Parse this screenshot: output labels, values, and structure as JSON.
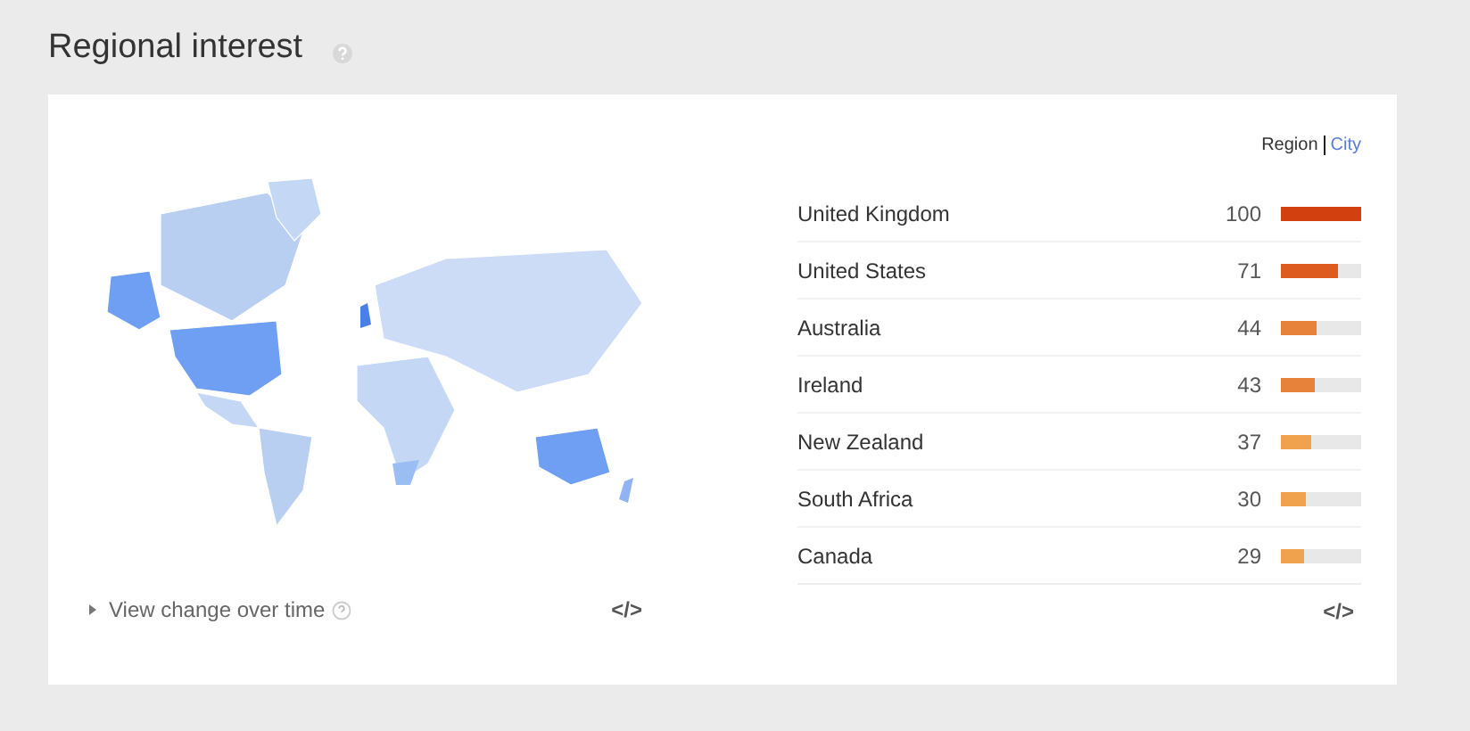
{
  "title": "Regional interest",
  "view_toggle": [
    {
      "label": "Region",
      "selected": true
    },
    {
      "label": "City",
      "selected": false
    }
  ],
  "regions": [
    {
      "name": "United Kingdom",
      "value": "100",
      "level": 1.0,
      "color": "#d24010"
    },
    {
      "name": "United States",
      "value": "71",
      "level": 0.71,
      "color": "#dd5b1f"
    },
    {
      "name": "Australia",
      "value": "44",
      "level": 0.44,
      "color": "#e6823a"
    },
    {
      "name": "Ireland",
      "value": "43",
      "level": 0.43,
      "color": "#e6823a"
    },
    {
      "name": "New Zealand",
      "value": "37",
      "level": 0.37,
      "color": "#f0a24c"
    },
    {
      "name": "South Africa",
      "value": "30",
      "level": 0.3,
      "color": "#f0a24c"
    },
    {
      "name": "Canada",
      "value": "29",
      "level": 0.29,
      "color": "#f0a24c"
    }
  ],
  "view_change_link": "View change over time",
  "embed_label": "</>"
}
